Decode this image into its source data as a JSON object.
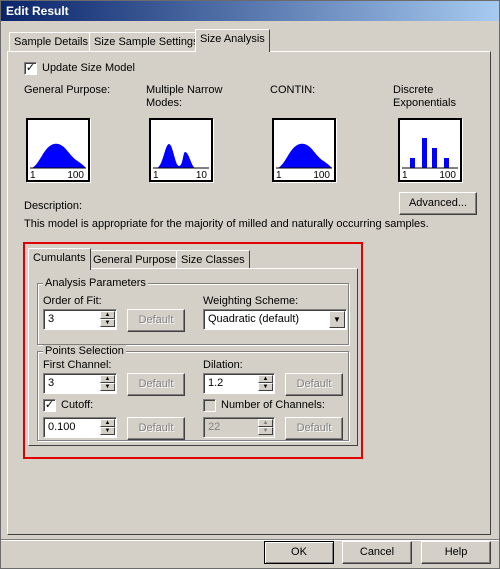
{
  "window": {
    "title": "Edit Result"
  },
  "tabs": [
    "Sample Details",
    "Size Sample Settings",
    "Size Analysis"
  ],
  "update_size_model": {
    "label": "Update Size Model",
    "checked": true,
    "mark": "✓"
  },
  "models": [
    {
      "label": "General Purpose:",
      "range_min": "1",
      "range_max": "100"
    },
    {
      "label": "Multiple Narrow Modes:",
      "range_min": "1",
      "range_max": "10"
    },
    {
      "label": "CONTIN:",
      "range_min": "1",
      "range_max": "100"
    },
    {
      "label": "Discrete Exponentials",
      "range_min": "1",
      "range_max": "100"
    }
  ],
  "description": {
    "label": "Description:",
    "text": "This model is appropriate for the majority of milled and naturally occurring samples."
  },
  "advanced_button": "Advanced...",
  "inner_tabs": [
    "Cumulants",
    "General Purpose",
    "Size Classes"
  ],
  "analysis_parameters": {
    "title": "Analysis Parameters",
    "order_of_fit_label": "Order of Fit:",
    "order_of_fit_value": "3",
    "default_label": "Default",
    "weighting_label": "Weighting Scheme:",
    "weighting_value": "Quadratic (default)"
  },
  "points_selection": {
    "title": "Points Selection",
    "first_channel_label": "First Channel:",
    "first_channel_value": "3",
    "dilation_label": "Dilation:",
    "dilation_value": "1.2",
    "cutoff_label": "Cutoff:",
    "cutoff_checked": true,
    "cutoff_value": "0.100",
    "num_channels_label": "Number of Channels:",
    "num_channels_checked": false,
    "num_channels_value": "22",
    "default_label": "Default"
  },
  "footer": {
    "ok": "OK",
    "cancel": "Cancel",
    "help": "Help"
  },
  "colors": {
    "highlight": "#e00000",
    "chart_fill": "#0000ff",
    "title_start": "#0a246a",
    "title_end": "#a6caf0"
  },
  "icons": {
    "spin_up": "▲",
    "spin_down": "▼",
    "dropdown": "▼"
  }
}
